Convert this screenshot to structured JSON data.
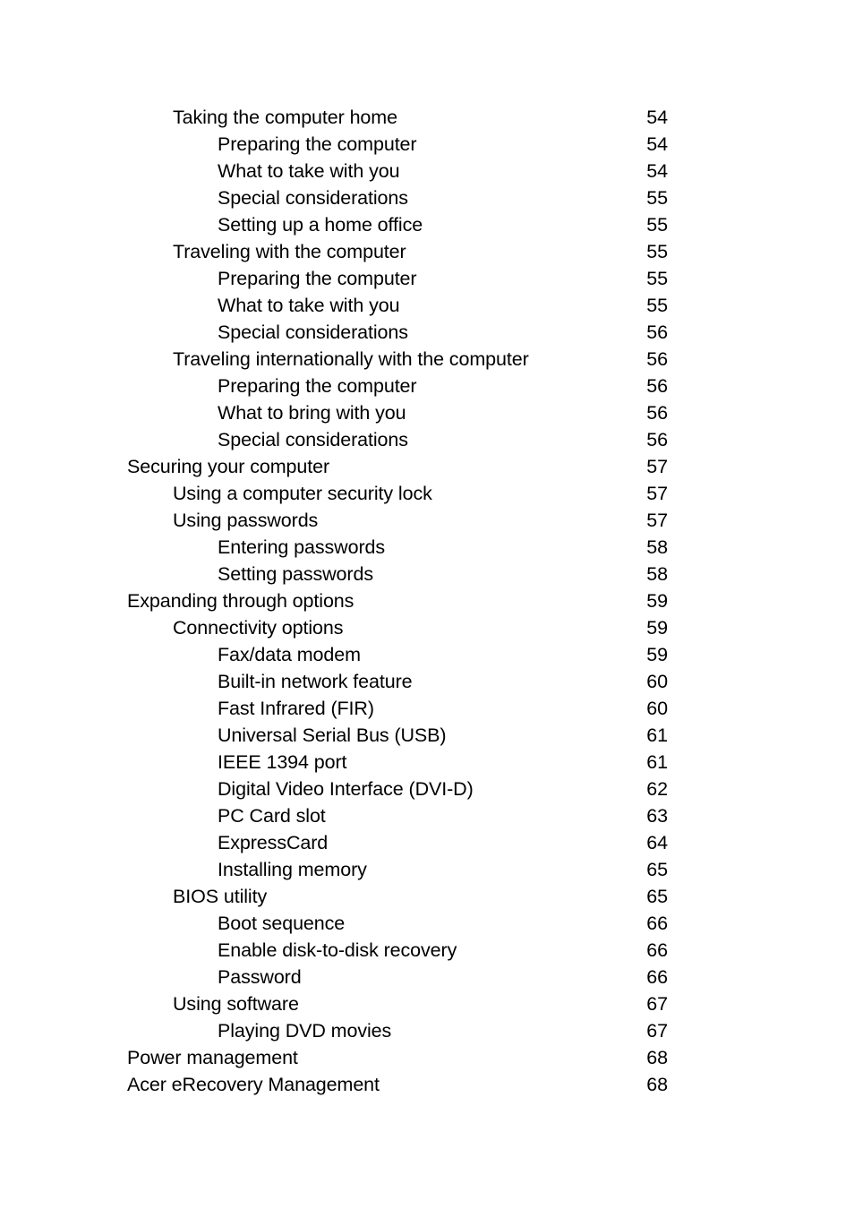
{
  "document": {
    "type": "table-of-contents",
    "page_background": "#ffffff",
    "text_color": "#000000"
  },
  "toc": {
    "entries": [
      {
        "title": "Taking the computer home",
        "page": "54",
        "level": 1
      },
      {
        "title": "Preparing the computer",
        "page": "54",
        "level": 2
      },
      {
        "title": "What to take with you",
        "page": "54",
        "level": 2
      },
      {
        "title": "Special considerations",
        "page": "55",
        "level": 2
      },
      {
        "title": "Setting up a home office",
        "page": "55",
        "level": 2
      },
      {
        "title": "Traveling with the computer",
        "page": "55",
        "level": 1
      },
      {
        "title": "Preparing the computer",
        "page": "55",
        "level": 2
      },
      {
        "title": "What to take with you",
        "page": "55",
        "level": 2
      },
      {
        "title": "Special considerations",
        "page": "56",
        "level": 2
      },
      {
        "title": "Traveling internationally with the computer",
        "page": "56",
        "level": 1
      },
      {
        "title": "Preparing the computer",
        "page": "56",
        "level": 2
      },
      {
        "title": "What to bring with you",
        "page": "56",
        "level": 2
      },
      {
        "title": "Special considerations",
        "page": "56",
        "level": 2
      },
      {
        "title": "Securing your computer",
        "page": "57",
        "level": 0
      },
      {
        "title": "Using a computer security lock",
        "page": "57",
        "level": 1
      },
      {
        "title": "Using passwords",
        "page": "57",
        "level": 1
      },
      {
        "title": "Entering passwords",
        "page": "58",
        "level": 2
      },
      {
        "title": "Setting passwords",
        "page": "58",
        "level": 2
      },
      {
        "title": "Expanding through options",
        "page": "59",
        "level": 0
      },
      {
        "title": "Connectivity options",
        "page": "59",
        "level": 1
      },
      {
        "title": "Fax/data modem",
        "page": "59",
        "level": 2
      },
      {
        "title": "Built-in network feature",
        "page": "60",
        "level": 2
      },
      {
        "title": "Fast Infrared (FIR)",
        "page": "60",
        "level": 2
      },
      {
        "title": "Universal Serial Bus (USB)",
        "page": "61",
        "level": 2
      },
      {
        "title": "IEEE 1394 port",
        "page": "61",
        "level": 2
      },
      {
        "title": "Digital Video Interface (DVI-D)",
        "page": "62",
        "level": 2
      },
      {
        "title": "PC Card slot",
        "page": "63",
        "level": 2
      },
      {
        "title": "ExpressCard",
        "page": "64",
        "level": 2
      },
      {
        "title": "Installing memory",
        "page": "65",
        "level": 2
      },
      {
        "title": "BIOS utility",
        "page": "65",
        "level": 1
      },
      {
        "title": "Boot sequence",
        "page": "66",
        "level": 2
      },
      {
        "title": "Enable disk-to-disk recovery",
        "page": "66",
        "level": 2
      },
      {
        "title": "Password",
        "page": "66",
        "level": 2
      },
      {
        "title": "Using software",
        "page": "67",
        "level": 1
      },
      {
        "title": "Playing DVD movies",
        "page": "67",
        "level": 2
      },
      {
        "title": "Power management",
        "page": "68",
        "level": 0
      },
      {
        "title": "Acer eRecovery Management",
        "page": "68",
        "level": 0
      }
    ]
  }
}
